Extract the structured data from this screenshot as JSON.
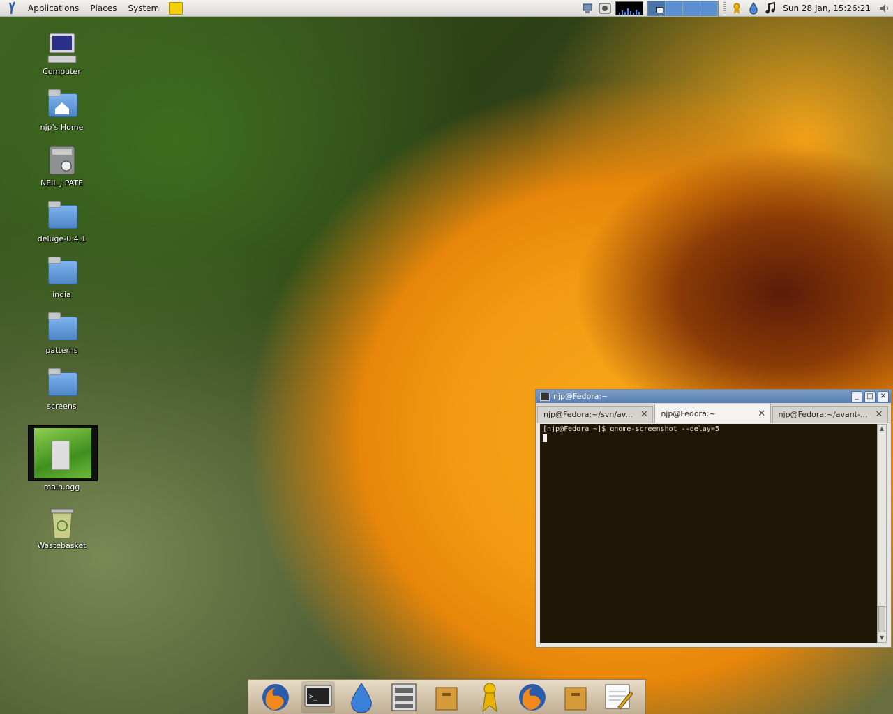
{
  "top_panel": {
    "menus": [
      "Applications",
      "Places",
      "System"
    ],
    "clock": "Sun 28 Jan, 15:26:21"
  },
  "desktop_icons": [
    {
      "label": "Computer"
    },
    {
      "label": "njp's Home"
    },
    {
      "label": "NEIL J PATE"
    },
    {
      "label": "deluge-0.4.1"
    },
    {
      "label": "india"
    },
    {
      "label": "patterns"
    },
    {
      "label": "screens"
    },
    {
      "label": "main.ogg"
    },
    {
      "label": "Wastebasket"
    }
  ],
  "terminal": {
    "title": "njp@Fedora:~",
    "tabs": [
      {
        "label": "njp@Fedora:~/svn/av..."
      },
      {
        "label": "njp@Fedora:~"
      },
      {
        "label": "njp@Fedora:~/avant-..."
      }
    ],
    "line1": "[njp@Fedora ~]$ gnome-screenshot --delay=5"
  },
  "dock_items": [
    {
      "icon": "firefox-icon"
    },
    {
      "icon": "terminal-icon"
    },
    {
      "icon": "waterdrop-icon"
    },
    {
      "icon": "file-cabinet-icon"
    },
    {
      "icon": "archive-icon"
    },
    {
      "icon": "award-icon"
    },
    {
      "icon": "firefox-icon"
    },
    {
      "icon": "archive-icon"
    },
    {
      "icon": "text-editor-icon"
    }
  ],
  "colors": {
    "panel": "#dcdad5",
    "terminal_bg": "#1f1606",
    "titlebar": "#547eb3"
  }
}
